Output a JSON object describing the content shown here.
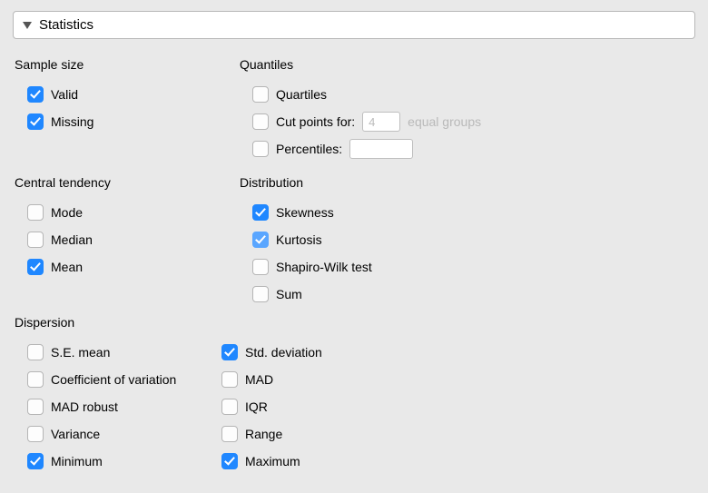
{
  "header": {
    "title": "Statistics"
  },
  "sampleSize": {
    "title": "Sample size",
    "valid": {
      "label": "Valid",
      "checked": true
    },
    "missing": {
      "label": "Missing",
      "checked": true
    }
  },
  "quantiles": {
    "title": "Quantiles",
    "quartiles": {
      "label": "Quartiles",
      "checked": false
    },
    "cutPoints": {
      "label": "Cut points for:",
      "checked": false,
      "value": "4",
      "suffix": "equal groups"
    },
    "percentiles": {
      "label": "Percentiles:",
      "checked": false,
      "value": ""
    }
  },
  "centralTendency": {
    "title": "Central tendency",
    "mode": {
      "label": "Mode",
      "checked": false
    },
    "median": {
      "label": "Median",
      "checked": false
    },
    "mean": {
      "label": "Mean",
      "checked": true
    }
  },
  "distribution": {
    "title": "Distribution",
    "skewness": {
      "label": "Skewness",
      "checked": true
    },
    "kurtosis": {
      "label": "Kurtosis",
      "checked": true,
      "highlight": true
    },
    "shapiro": {
      "label": "Shapiro-Wilk test",
      "checked": false
    },
    "sum": {
      "label": "Sum",
      "checked": false
    }
  },
  "dispersion": {
    "title": "Dispersion",
    "left": {
      "seMean": {
        "label": "S.E. mean",
        "checked": false
      },
      "cov": {
        "label": "Coefficient of variation",
        "checked": false
      },
      "madRobust": {
        "label": "MAD robust",
        "checked": false
      },
      "variance": {
        "label": "Variance",
        "checked": false
      },
      "minimum": {
        "label": "Minimum",
        "checked": true
      }
    },
    "right": {
      "stdDev": {
        "label": "Std. deviation",
        "checked": true
      },
      "mad": {
        "label": "MAD",
        "checked": false
      },
      "iqr": {
        "label": "IQR",
        "checked": false
      },
      "range": {
        "label": "Range",
        "checked": false
      },
      "maximum": {
        "label": "Maximum",
        "checked": true
      }
    }
  }
}
